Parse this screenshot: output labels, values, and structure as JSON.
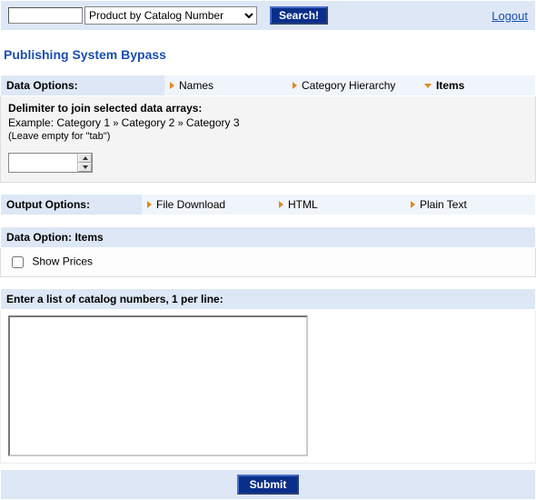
{
  "topbar": {
    "search_value": "",
    "dropdown_selected": "Product by Catalog Number",
    "search_button": "Search!",
    "logout": "Logout"
  },
  "title": "Publishing System Bypass",
  "data_options": {
    "header": "Data Options:",
    "tabs": [
      "Names",
      "Category Hierarchy",
      "Items"
    ],
    "active_index": 2
  },
  "delimiter": {
    "label": "Delimiter to join selected data arrays:",
    "example_prefix": "Example: ",
    "example_parts": [
      "Category 1",
      "Category 2",
      "Category 3"
    ],
    "hint": "(Leave empty for \"tab\")",
    "value": ""
  },
  "output_options": {
    "header": "Output Options:",
    "tabs": [
      "File Download",
      "HTML",
      "Plain Text"
    ]
  },
  "item_options": {
    "header": "Data Option: Items",
    "show_prices_label": "Show Prices",
    "show_prices_checked": false
  },
  "catalog": {
    "header": "Enter a list of catalog numbers, 1 per line:",
    "value": ""
  },
  "submit_label": "Submit"
}
